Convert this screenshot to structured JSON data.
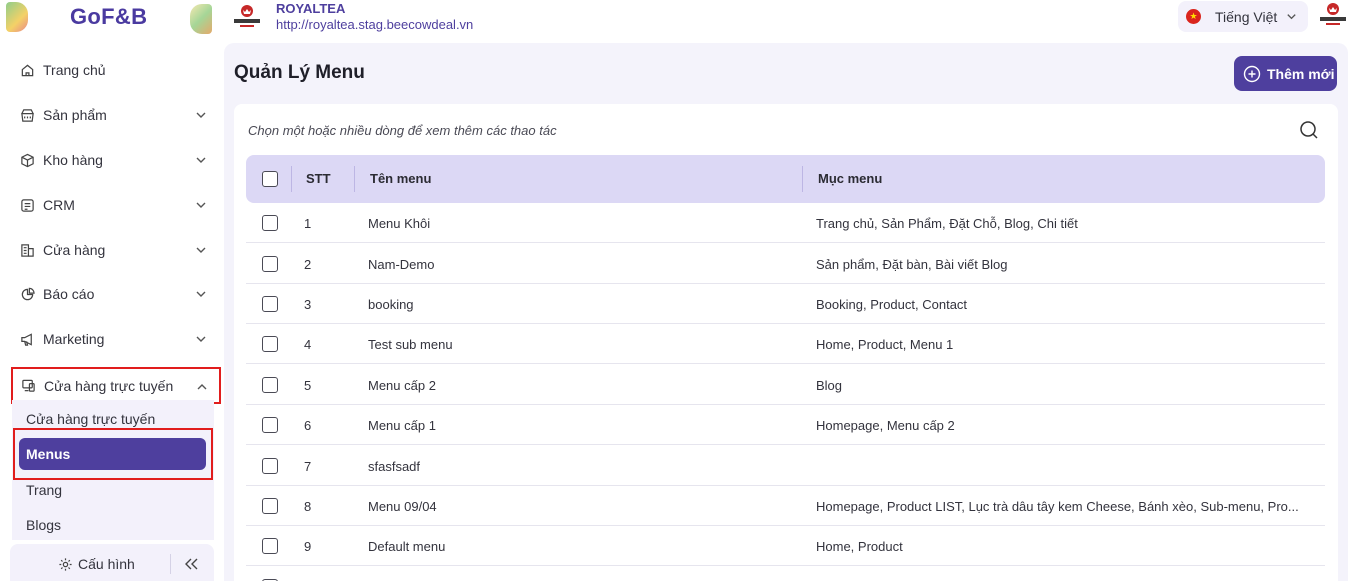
{
  "brand": {
    "logo_text": "GoF&B"
  },
  "shop": {
    "name": "ROYALTEA",
    "url": "http://royaltea.stag.beecowdeal.vn"
  },
  "header": {
    "language": "Tiếng Việt"
  },
  "sidebar": {
    "items": [
      {
        "label": "Trang chủ",
        "icon": "home-icon"
      },
      {
        "label": "Sản phẩm",
        "icon": "product-icon"
      },
      {
        "label": "Kho hàng",
        "icon": "box-icon"
      },
      {
        "label": "CRM",
        "icon": "crm-icon"
      },
      {
        "label": "Cửa hàng",
        "icon": "store-icon"
      },
      {
        "label": "Báo cáo",
        "icon": "chart-icon"
      },
      {
        "label": "Marketing",
        "icon": "megaphone-icon"
      },
      {
        "label": "Cửa hàng trực tuyến",
        "icon": "online-store-icon"
      }
    ],
    "subitems": [
      {
        "label": "Cửa hàng trực tuyến"
      },
      {
        "label": "Menus"
      },
      {
        "label": "Trang"
      },
      {
        "label": "Blogs"
      }
    ],
    "config_label": "Cấu hình"
  },
  "main": {
    "title": "Quản Lý Menu",
    "add_button": "Thêm mới",
    "hint": "Chọn một hoặc nhiều dòng để xem thêm các thao tác",
    "columns": {
      "stt": "STT",
      "name": "Tên menu",
      "items": "Mục menu"
    },
    "rows": [
      {
        "stt": "1",
        "name": "Menu Khôi",
        "items": "Trang chủ, Sản Phẩm, Đặt Chỗ, Blog, Chi tiết"
      },
      {
        "stt": "2",
        "name": "Nam-Demo",
        "items": "Sản phẩm, Đặt bàn, Bài viết Blog"
      },
      {
        "stt": "3",
        "name": "booking",
        "items": "Booking, Product, Contact"
      },
      {
        "stt": "4",
        "name": "Test sub menu",
        "items": "Home, Product, Menu 1"
      },
      {
        "stt": "5",
        "name": "Menu cấp 2",
        "items": "Blog"
      },
      {
        "stt": "6",
        "name": "Menu cấp 1",
        "items": "Homepage, Menu cấp 2"
      },
      {
        "stt": "7",
        "name": "sfasfsadf",
        "items": ""
      },
      {
        "stt": "8",
        "name": "Menu 09/04",
        "items": "Homepage, Product LIST, Lục trà dâu tây kem Cheese, Bánh xèo, Sub-menu, Pro..."
      },
      {
        "stt": "9",
        "name": "Default menu",
        "items": "Home, Product"
      }
    ]
  },
  "colors": {
    "accent": "#4e3f9e",
    "header_row": "#dcd8f5",
    "highlight": "#e11d1d"
  }
}
